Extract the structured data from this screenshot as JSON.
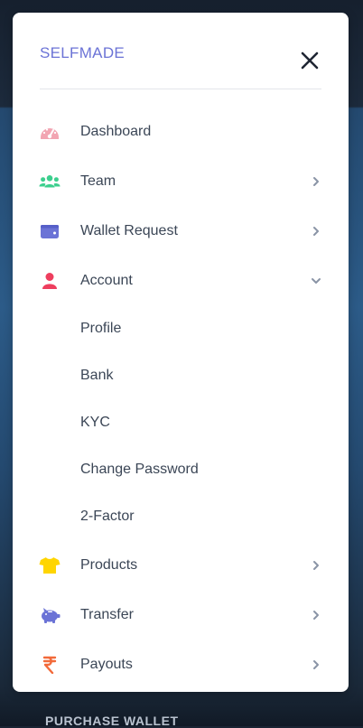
{
  "brand": "SELFMADE",
  "background_text": "PURCHASE WALLET",
  "colors": {
    "brand": "#6b73d6",
    "text": "#3b4656",
    "chevron": "#8a94a6"
  },
  "menu": {
    "dashboard": {
      "label": "Dashboard",
      "icon": "speedometer-icon"
    },
    "team": {
      "label": "Team",
      "icon": "users-icon"
    },
    "wallet": {
      "label": "Wallet Request",
      "icon": "wallet-icon"
    },
    "account": {
      "label": "Account",
      "icon": "user-icon",
      "submenu": [
        "Profile",
        "Bank",
        "KYC",
        "Change Password",
        "2-Factor"
      ]
    },
    "products": {
      "label": "Products",
      "icon": "tshirt-icon"
    },
    "transfer": {
      "label": "Transfer",
      "icon": "piggy-bank-icon"
    },
    "payouts": {
      "label": "Payouts",
      "icon": "rupee-icon"
    }
  }
}
